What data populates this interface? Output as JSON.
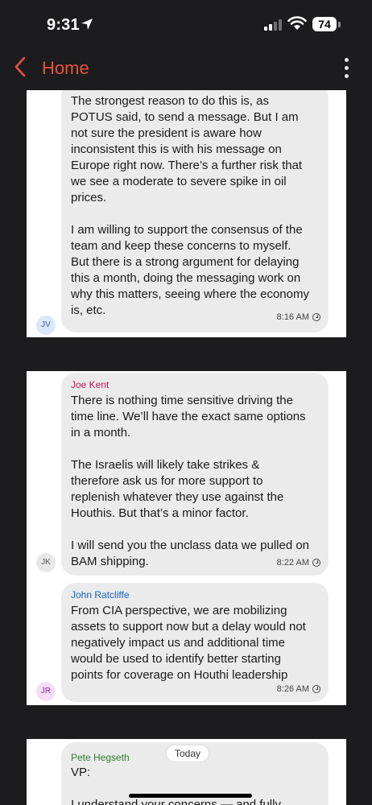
{
  "status_bar": {
    "time": "9:31",
    "battery": "74"
  },
  "nav": {
    "back_label": "Home"
  },
  "messages": [
    {
      "text": "The strongest reason to do this is, as POTUS said, to send a message.  But I am not sure the president is aware how inconsistent this is with his message on Europe right now. There’s a further risk that we see a moderate to severe spike in oil prices.\n\nI am willing to support the consensus of the team and keep these concerns to myself. But there is a strong argument for delaying this a month, doing the messaging work on why this matters, seeing where the economy is, etc.",
      "time": "8:16 AM",
      "initials": "JV"
    },
    {
      "sender": "Joe Kent",
      "text": "There is nothing time sensitive driving the time line. We’ll have the exact same options in a month.\n\nThe Israelis will likely take strikes & therefore ask us for more support to replenish whatever they use against the Houthis. But that’s a minor factor.\n\nI will send you the unclass data we pulled on BAM shipping.",
      "time": "8:22 AM",
      "initials": "JK"
    },
    {
      "sender": "John Ratcliffe",
      "text": "From CIA perspective, we are mobilizing assets to support now but a delay would not negatively impact us and additional time would be used to identify better starting points for coverage on Houthi leadership",
      "time": "8:26 AM",
      "initials": "JR"
    },
    {
      "sender": "Pete Hegseth",
      "text": "VP:\n\nI understand your concerns — and fully"
    }
  ],
  "date_separator": "Today",
  "colors": {
    "accent": "#e8513f",
    "sender_joe_kent": "#c2185b",
    "sender_john_ratcliffe": "#1565c0",
    "sender_pete_hegseth": "#2e7d32",
    "avatar_jv_bg": "#dbe7fb",
    "avatar_jk_bg": "#e8e8e8",
    "avatar_jr_bg": "#f7dcf5"
  },
  "icons": [
    "location-arrow-icon",
    "cellular-signal-icon",
    "wifi-icon",
    "battery-icon",
    "chevron-left-icon",
    "more-vertical-icon",
    "clock-icon"
  ]
}
